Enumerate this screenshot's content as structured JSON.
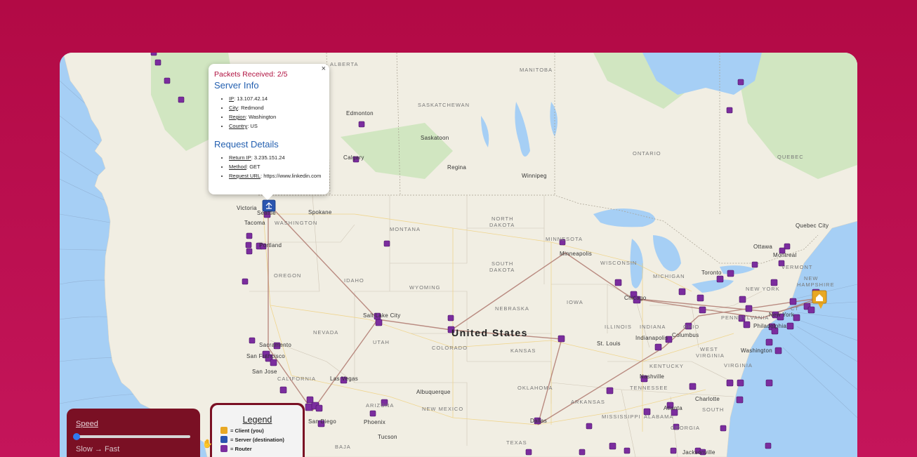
{
  "popup": {
    "close": "×",
    "packets": "Packets Received: 2/5",
    "server_heading": "Server Info",
    "server": [
      {
        "key": "IP",
        "value": ": 13.107.42.14"
      },
      {
        "key": "City",
        "value": ": Redmond"
      },
      {
        "key": "Region",
        "value": ": Washington"
      },
      {
        "key": "Country",
        "value": ": US"
      }
    ],
    "request_heading": "Request Details",
    "request": [
      {
        "key": "Return IP",
        "value": ": 3.235.151.24"
      },
      {
        "key": "Method",
        "value": ": GET"
      },
      {
        "key": "Request URL",
        "value": ": https://www.linkedin.com"
      }
    ]
  },
  "speed": {
    "title": "Speed",
    "range": "Slow → Fast",
    "value": 0
  },
  "legend": {
    "title": "Legend",
    "client": "= Client (you)",
    "server": "= Server (destination)",
    "router": "= Router"
  },
  "labels": {
    "alberta": "ALBERTA",
    "manitoba": "MANITOBA",
    "saskatchewan": "SASKATCHEWAN",
    "edmonton": "Edmonton",
    "saskatoon": "Saskatoon",
    "calgary": "Calgary",
    "regina": "Regina",
    "winnipeg": "Winnipeg",
    "ontario": "ONTARIO",
    "quebec": "QUEBEC",
    "victoria": "Victoria",
    "seattle": "Seattle",
    "tacoma": "Tacoma",
    "spokane": "Spokane",
    "washington": "WASHINGTON",
    "portland": "Portland",
    "oregon": "OREGON",
    "idaho": "IDAHO",
    "montana": "MONTANA",
    "north_dakota_1": "NORTH",
    "north_dakota_2": "DAKOTA",
    "south_dakota_1": "SOUTH",
    "south_dakota_2": "DAKOTA",
    "minnesota": "MINNESOTA",
    "minneapolis": "Minneapolis",
    "wisconsin": "WISCONSIN",
    "michigan": "MICHIGAN",
    "wyoming": "WYOMING",
    "nebraska": "NEBRASKA",
    "iowa": "IOWA",
    "illinois": "ILLINOIS",
    "indiana": "INDIANA",
    "ohio": "OHIO",
    "nevada": "NEVADA",
    "utah": "UTAH",
    "colorado": "COLORADO",
    "kansas": "KANSAS",
    "salt_lake": "Salt Lake City",
    "united_states": "United States",
    "sacramento": "Sacramento",
    "san_francisco": "San Francisco",
    "san_jose": "San Jose",
    "california": "CALIFORNIA",
    "las_vegas": "Las Vegas",
    "arizona": "ARIZONA",
    "new_mexico": "NEW MEXICO",
    "albuquerque": "Albuquerque",
    "oklahoma": "OKLAHOMA",
    "arkansas": "ARKANSAS",
    "texas": "TEXAS",
    "dallas": "Dallas",
    "san_diego": "San Diego",
    "phoenix": "Phoenix",
    "tucson": "Tucson",
    "baja": "BAJA",
    "chicago": "Chicago",
    "st_louis": "St. Louis",
    "indianapolis": "Indianapolis",
    "columbus": "Columbus",
    "kentucky": "KENTUCKY",
    "tennessee": "TENNESSEE",
    "nashville": "Nashville",
    "mississippi": "MISSISSIPPI",
    "alabama": "ALABAMA",
    "atlanta": "Atlanta",
    "georgia": "GEORGIA",
    "south_carolina": "SOUTH",
    "charlotte": "Charlotte",
    "jacksonville": "Jacksonville",
    "toronto": "Toronto",
    "ottawa": "Ottawa",
    "montreal": "Montreal",
    "quebec_city": "Quebec City",
    "vermont": "VERMONT",
    "new_hampshire_1": "NEW",
    "new_hampshire_2": "HAMPSHIRE",
    "new_york": "NEW YORK",
    "pennsylvania": "PENNSYLVANIA",
    "philadelphia": "Philadelphia",
    "washington_dc": "Washington",
    "west_virginia_1": "WEST",
    "west_virginia_2": "VIRGINIA",
    "virginia": "VIRGINIA",
    "ct": "CT",
    "new_york_city": "New York"
  },
  "colors": {
    "router": "#7b2d9e",
    "server": "#2a55b0",
    "client": "#e8a824",
    "route": "#b07a70",
    "water": "#a6cff5",
    "land": "#f2efe6"
  }
}
